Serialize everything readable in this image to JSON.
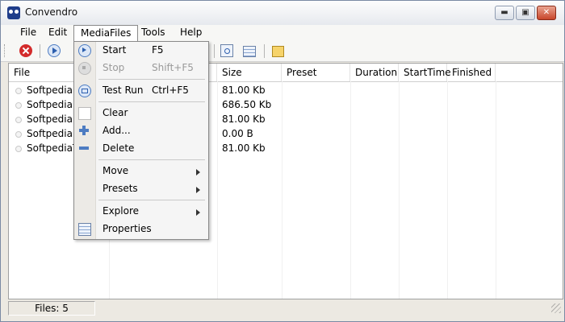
{
  "window": {
    "title": "Convendro",
    "minimize_glyph": "▬",
    "maximize_glyph": "▣",
    "close_glyph": "✕"
  },
  "menubar": [
    {
      "label": "File"
    },
    {
      "label": "Edit"
    },
    {
      "label": "MediaFiles"
    },
    {
      "label": "Tools"
    },
    {
      "label": "Help"
    }
  ],
  "toolbar": {
    "icons": [
      "stop-icon",
      "play-icon",
      "find-icon",
      "grid-icon",
      "edit-icon"
    ]
  },
  "table": {
    "columns": [
      "File",
      "Size",
      "Preset",
      "Duration",
      "StartTime",
      "Finished"
    ],
    "rows": [
      {
        "file": "Softpedia.av",
        "size": "81.00 Kb"
      },
      {
        "file": "Softpedia te",
        "size": "686.50 Kb"
      },
      {
        "file": "Softpedia Te",
        "size": "81.00 Kb"
      },
      {
        "file": "Softpedia Te",
        "size": "0.00 B"
      },
      {
        "file": "SoftpediaTe",
        "size": "81.00 Kb"
      }
    ]
  },
  "dropdown": {
    "items": [
      {
        "label": "Start",
        "shortcut": "F5",
        "icon": "start-icon",
        "disabled": false
      },
      {
        "label": "Stop",
        "shortcut": "Shift+F5",
        "icon": "stop-icon",
        "disabled": true
      },
      {
        "label": "Test Run",
        "shortcut": "Ctrl+F5",
        "icon": "test-run-icon",
        "disabled": false
      },
      {
        "label": "Clear",
        "shortcut": "",
        "icon": "clear-icon",
        "disabled": false
      },
      {
        "label": "Add...",
        "shortcut": "",
        "icon": "add-icon",
        "disabled": false
      },
      {
        "label": "Delete",
        "shortcut": "",
        "icon": "delete-icon",
        "disabled": false
      },
      {
        "label": "Move",
        "shortcut": "",
        "icon": "",
        "submenu": true
      },
      {
        "label": "Presets",
        "shortcut": "",
        "icon": "",
        "submenu": true
      },
      {
        "label": "Explore",
        "shortcut": "",
        "icon": "",
        "submenu": true
      },
      {
        "label": "Properties",
        "shortcut": "",
        "icon": "properties-icon",
        "disabled": false
      }
    ]
  },
  "statusbar": {
    "files": "Files: 5"
  }
}
